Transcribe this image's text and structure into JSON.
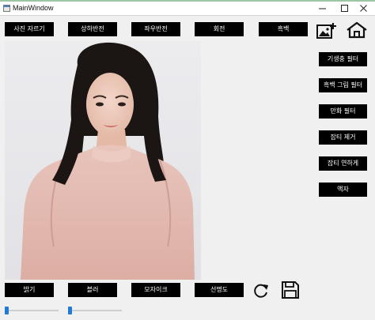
{
  "window": {
    "title": "MainWindow"
  },
  "toolbar": {
    "crop_label": "사진 자르기",
    "flip_vertical_label": "상하반전",
    "flip_horizontal_label": "좌우반전",
    "rotate_label": "회전",
    "grayscale_label": "흑백"
  },
  "side_panel": {
    "oil_filter_label": "기생충 필터",
    "bw_sketch_label": "흑백 그림 필터",
    "cartoon_label": "만화 필터",
    "denoise_label": "잡티 제거",
    "soften_label": "잡티 연하게",
    "frame_label": "액자"
  },
  "bottom_bar": {
    "brightness_label": "밝기",
    "blur_label": "블러",
    "mosaic_label": "모자이크",
    "sharpness_label": "선명도"
  },
  "sliders": {
    "slider_1_value": 0,
    "slider_2_value": 0
  },
  "icons": {
    "add_image": "add-image-icon",
    "home": "home-icon",
    "refresh": "refresh-icon",
    "save": "save-icon"
  },
  "colors": {
    "button_bg": "#000000",
    "button_text": "#ffffff",
    "slider_handle": "#1f7ad8",
    "window_bg": "#f0f0f0"
  }
}
